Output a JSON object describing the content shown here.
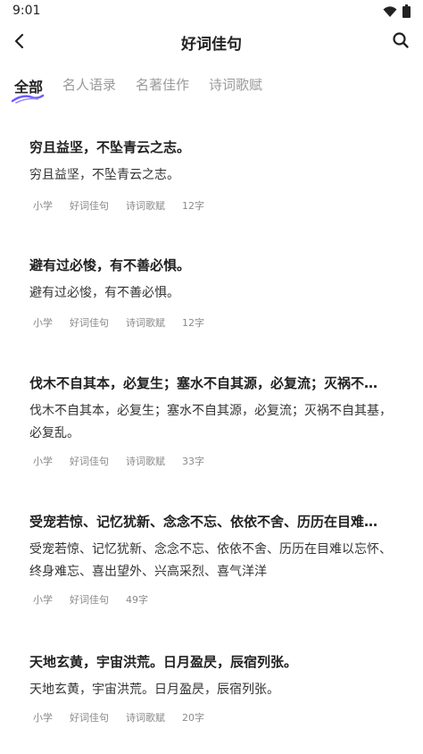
{
  "status": {
    "time": "9:01"
  },
  "nav": {
    "title": "好词佳句"
  },
  "tabs": [
    {
      "label": "全部",
      "active": true
    },
    {
      "label": "名人语录"
    },
    {
      "label": "名著佳作"
    },
    {
      "label": "诗词歌赋"
    }
  ],
  "items": [
    {
      "title": "穷且益坚，不坠青云之志。",
      "body": "穷且益坚，不坠青云之志。",
      "tags": [
        "小学",
        "好词佳句",
        "诗词歌赋",
        "12字"
      ]
    },
    {
      "title": "避有过必悛，有不善必惧。",
      "body": "避有过必悛，有不善必惧。",
      "tags": [
        "小学",
        "好词佳句",
        "诗词歌赋",
        "12字"
      ]
    },
    {
      "title": "伐木不自其本，必复生；塞水不自其源，必复流；灭祸不…",
      "body": "伐木不自其本，必复生；塞水不自其源，必复流；灭祸不自其基，必复乱。",
      "tags": [
        "小学",
        "好词佳句",
        "诗词歌赋",
        "33字"
      ]
    },
    {
      "title": "受宠若惊、记忆犹新、念念不忘、依依不舍、历历在目难…",
      "body": "受宠若惊、记忆犹新、念念不忘、依依不舍、历历在目难以忘怀、终身难忘、喜出望外、兴高采烈、喜气洋洋",
      "tags": [
        "小学",
        "好词佳句",
        "49字"
      ]
    },
    {
      "title": "天地玄黄，宇宙洪荒。日月盈昃，辰宿列张。",
      "body": "天地玄黄，宇宙洪荒。日月盈昃，辰宿列张。",
      "tags": [
        "小学",
        "好词佳句",
        "诗词歌赋",
        "20字"
      ]
    }
  ],
  "colors": {
    "accent": "#6a5cff",
    "text": "#222222",
    "muted": "#8a8a8a"
  }
}
